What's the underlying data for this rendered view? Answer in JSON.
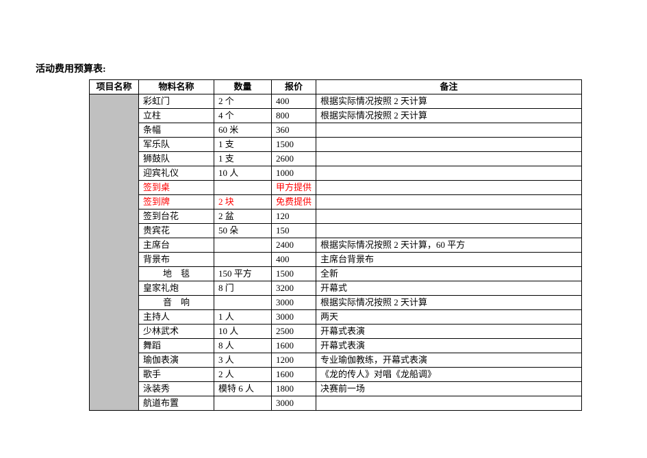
{
  "title": "活动费用预算表:",
  "headers": {
    "project": "项目名称",
    "material": "物料名称",
    "qty": "数量",
    "price": "报价",
    "remark": "备注"
  },
  "rows": [
    {
      "material": "彩虹门",
      "qty": "2 个",
      "price": "400",
      "remark": "根据实际情况按照 2 天计算",
      "red": false,
      "material_center": false
    },
    {
      "material": "立柱",
      "qty": "4 个",
      "price": "800",
      "remark": "根据实际情况按照 2 天计算",
      "red": false,
      "material_center": false
    },
    {
      "material": "条幅",
      "qty": "60 米",
      "price": "360",
      "remark": "",
      "red": false,
      "material_center": false
    },
    {
      "material": "军乐队",
      "qty": "1 支",
      "price": "1500",
      "remark": "",
      "red": false,
      "material_center": false
    },
    {
      "material": "狮鼓队",
      "qty": "1 支",
      "price": "2600",
      "remark": "",
      "red": false,
      "material_center": false
    },
    {
      "material": "迎宾礼仪",
      "qty": "10 人",
      "price": "1000",
      "remark": "",
      "red": false,
      "material_center": false
    },
    {
      "material": "签到桌",
      "qty": "",
      "price": "甲方提供",
      "remark": "",
      "red": true,
      "material_center": false
    },
    {
      "material": "签到牌",
      "qty": "2 块",
      "price": "免费提供",
      "remark": "",
      "red": true,
      "material_center": false
    },
    {
      "material": "签到台花",
      "qty": "2 盆",
      "price": "120",
      "remark": "",
      "red": false,
      "material_center": false
    },
    {
      "material": "贵宾花",
      "qty": "50 朵",
      "price": "150",
      "remark": "",
      "red": false,
      "material_center": false
    },
    {
      "material": "主席台",
      "qty": "",
      "price": "2400",
      "remark": "根据实际情况按照 2 天计算，60 平方",
      "red": false,
      "material_center": false
    },
    {
      "material": "背景布",
      "qty": "",
      "price": "400",
      "remark": "主席台背景布",
      "red": false,
      "material_center": false
    },
    {
      "material": "地　毯",
      "qty": "150 平方",
      "price": "1500",
      "remark": "全新",
      "red": false,
      "material_center": true
    },
    {
      "material": "皇家礼炮",
      "qty": "8 门",
      "price": "3200",
      "remark": "开幕式",
      "red": false,
      "material_center": false
    },
    {
      "material": "音　响",
      "qty": "",
      "price": "3000",
      "remark": "根据实际情况按照 2 天计算",
      "red": false,
      "material_center": true
    },
    {
      "material": "主持人",
      "qty": "1 人",
      "price": "3000",
      "remark": "两天",
      "red": false,
      "material_center": false
    },
    {
      "material": "少林武术",
      "qty": "10 人",
      "price": "2500",
      "remark": "开幕式表演",
      "red": false,
      "material_center": false
    },
    {
      "material": "舞蹈",
      "qty": "8 人",
      "price": "1600",
      "remark": "开幕式表演",
      "red": false,
      "material_center": false
    },
    {
      "material": "瑜伽表演",
      "qty": "3 人",
      "price": "1200",
      "remark": "专业瑜伽教练，开幕式表演",
      "red": false,
      "material_center": false
    },
    {
      "material": "歌手",
      "qty": "2 人",
      "price": "1600",
      "remark": "《龙的传人》对唱《龙船调》",
      "red": false,
      "material_center": false
    },
    {
      "material": "泳装秀",
      "qty": "模特 6 人",
      "price": "1800",
      "remark": "决赛前一场",
      "red": false,
      "material_center": false
    },
    {
      "material": "航道布置",
      "qty": "",
      "price": "3000",
      "remark": "",
      "red": false,
      "material_center": false
    }
  ]
}
